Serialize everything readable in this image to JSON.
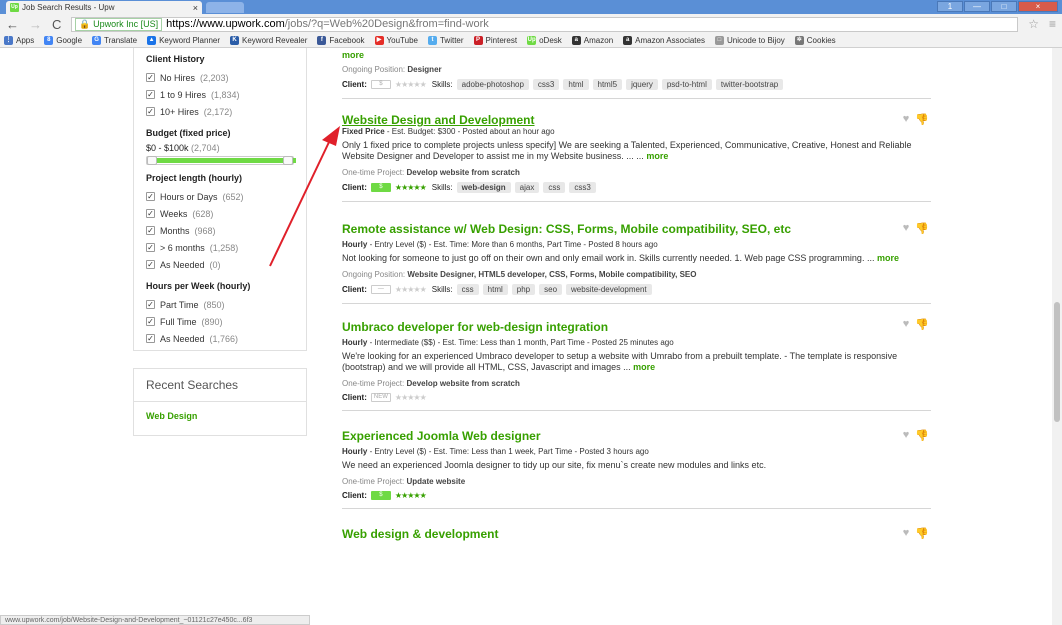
{
  "browser": {
    "tab_title": "Job Search Results - Upw",
    "tab_close": "×",
    "favicon_text": "Up",
    "url_secure_label": "Upwork Inc [US]",
    "url_host": "https://www.upwork.com",
    "url_path": "/jobs/?q=Web%20Design&from=find-work",
    "window_buttons": [
      "1",
      "—",
      "□",
      "×"
    ]
  },
  "bookmarks": [
    {
      "label": "Apps",
      "color": "#4a78c8",
      "glyph": "⋮"
    },
    {
      "label": "Google",
      "color": "#4285f4",
      "glyph": "8"
    },
    {
      "label": "Translate",
      "color": "#4285f4",
      "glyph": "G"
    },
    {
      "label": "Keyword Planner",
      "color": "#1a73e8",
      "glyph": "▲"
    },
    {
      "label": "Keyword Revealer",
      "color": "#2b5da8",
      "glyph": "K"
    },
    {
      "label": "Facebook",
      "color": "#3b5998",
      "glyph": "f"
    },
    {
      "label": "YouTube",
      "color": "#e52d27",
      "glyph": "▶"
    },
    {
      "label": "Twitter",
      "color": "#55acee",
      "glyph": "t"
    },
    {
      "label": "Pinterest",
      "color": "#cb2027",
      "glyph": "P"
    },
    {
      "label": "oDesk",
      "color": "#6fda44",
      "glyph": "Up"
    },
    {
      "label": "Amazon",
      "color": "#333",
      "glyph": "a"
    },
    {
      "label": "Amazon Associates",
      "color": "#333",
      "glyph": "a"
    },
    {
      "label": "Unicode to Bijoy",
      "color": "#999",
      "glyph": "□"
    },
    {
      "label": "Cookies",
      "color": "#777",
      "glyph": "✲"
    }
  ],
  "sidebar": {
    "client_history_title": "Client History",
    "client_history": [
      {
        "label": "No Hires",
        "count": "(2,203)"
      },
      {
        "label": "1 to 9 Hires",
        "count": "(1,834)"
      },
      {
        "label": "10+ Hires",
        "count": "(2,172)"
      }
    ],
    "budget_title": "Budget (fixed price)",
    "budget_range": "$0 - $100k",
    "budget_count": "(2,704)",
    "project_length_title": "Project length (hourly)",
    "project_length": [
      {
        "label": "Hours or Days",
        "count": "(652)"
      },
      {
        "label": "Weeks",
        "count": "(628)"
      },
      {
        "label": "Months",
        "count": "(968)"
      },
      {
        "label": "> 6 months",
        "count": "(1,258)"
      },
      {
        "label": "As Needed",
        "count": "(0)"
      }
    ],
    "hours_title": "Hours per Week (hourly)",
    "hours": [
      {
        "label": "Part Time",
        "count": "(850)"
      },
      {
        "label": "Full Time",
        "count": "(890)"
      },
      {
        "label": "As Needed",
        "count": "(1,766)"
      }
    ],
    "recent_title": "Recent Searches",
    "recent_item": "Web Design",
    "status_url": "www.upwork.com/job/Website-Design-and-Development_~01121c27e450c...6f3"
  },
  "jobs": {
    "top": {
      "more": "more",
      "proj_label": "Ongoing Position:",
      "proj_value": "Designer",
      "client_label": "Client:",
      "skills_label": "Skills:",
      "skills": [
        "adobe-photoshop",
        "css3",
        "html",
        "html5",
        "jquery",
        "psd-to-html",
        "twitter-bootstrap"
      ]
    },
    "j1": {
      "title": "Website Design and Development",
      "type": "Fixed Price",
      "meta": " - Est. Budget: $300 - Posted about an hour ago",
      "desc": "Only 1 fixed price to complete projects unless specify] We are seeking a Talented, Experienced, Communicative, Creative, Honest and Reliable Website Designer and Developer to assist me in my Website business. ... ...",
      "more": "more",
      "proj_label": "One-time Project:",
      "proj_value": "Develop website from scratch",
      "client_label": "Client:",
      "skills_label": "Skills:",
      "skills": [
        "web-design",
        "ajax",
        "css",
        "css3"
      ]
    },
    "j2": {
      "title": "Remote assistance w/ Web Design: CSS, Forms, Mobile compatibility, SEO, etc",
      "type": "Hourly",
      "meta": " - Entry Level ($) - Est. Time: More than 6 months, Part Time - Posted 8 hours ago",
      "desc": "Not looking for someone to just go off on their own and only email work in. Skills currently needed. 1. Web page CSS programming. ...",
      "more": "more",
      "proj_label": "Ongoing Position:",
      "proj_value": "Website Designer, HTML5 developer, CSS, Forms, Mobile compatibility, SEO",
      "client_label": "Client:",
      "skills_label": "Skills:",
      "skills": [
        "css",
        "html",
        "php",
        "seo",
        "website-development"
      ]
    },
    "j3": {
      "title": "Umbraco developer for web-design integration",
      "type": "Hourly",
      "meta": " - Intermediate ($$) - Est. Time: Less than 1 month, Part Time - Posted 25 minutes ago",
      "desc": "We're looking for an experienced Umbraco developer to setup a website with Umrabo from a prebuilt template. - The template is responsive (bootstrap) and we will provide all HTML, CSS, Javascript and images ...",
      "more": "more",
      "proj_label": "One-time Project:",
      "proj_value": "Develop website from scratch",
      "client_label": "Client:",
      "badge": "NEW"
    },
    "j4": {
      "title": "Experienced Joomla Web designer",
      "type": "Hourly",
      "meta": " - Entry Level ($) - Est. Time: Less than 1 week, Part Time - Posted 3 hours ago",
      "desc": "We need an experienced Joomla designer to tidy up our site, fix menu`s create new modules and links etc.",
      "proj_label": "One-time Project:",
      "proj_value": "Update website",
      "client_label": "Client:"
    },
    "j5": {
      "title": "Web design & development"
    }
  }
}
